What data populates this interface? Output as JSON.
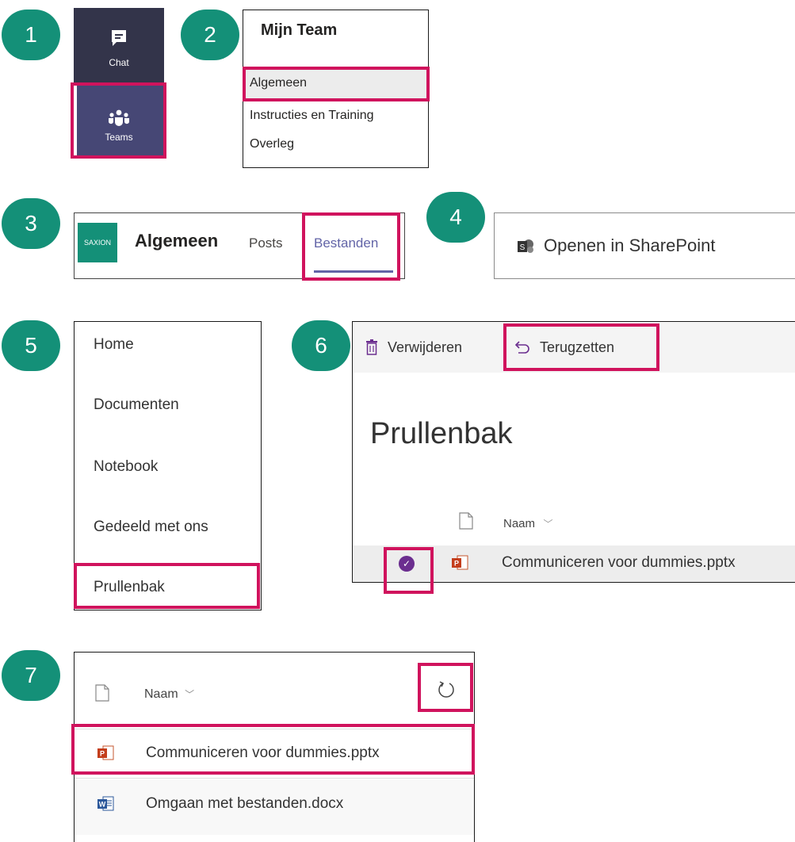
{
  "steps": [
    "1",
    "2",
    "3",
    "4",
    "5",
    "6",
    "7"
  ],
  "panel1": {
    "chat_label": "Chat",
    "teams_label": "Teams",
    "icon_chat": "chat-icon",
    "icon_teams": "teams-icon"
  },
  "panel2": {
    "title": "Mijn Team",
    "channels": [
      "Algemeen",
      "Instructies en Training",
      "Overleg"
    ]
  },
  "panel3": {
    "logo_text": "SAXION",
    "channel_name": "Algemeen",
    "tab_posts": "Posts",
    "tab_files": "Bestanden"
  },
  "panel4": {
    "button_label": "Openen in SharePoint",
    "icon": "sharepoint-icon"
  },
  "panel5": {
    "nav": [
      "Home",
      "Documenten",
      "Notebook",
      "Gedeeld met ons",
      "Prullenbak"
    ]
  },
  "panel6": {
    "delete_label": "Verwijderen",
    "restore_label": "Terugzetten",
    "page_title": "Prullenbak",
    "column_name": "Naam",
    "file_name": "Communiceren voor dummies.pptx"
  },
  "panel7": {
    "column_name": "Naam",
    "files": [
      "Communiceren voor dummies.pptx",
      "Omgaan met bestanden.docx"
    ],
    "icon_refresh": "refresh-icon"
  },
  "colors": {
    "step_badge": "#149078",
    "highlight": "#d0135d",
    "teams_rail": "#33344a",
    "accent": "#6264a7"
  }
}
